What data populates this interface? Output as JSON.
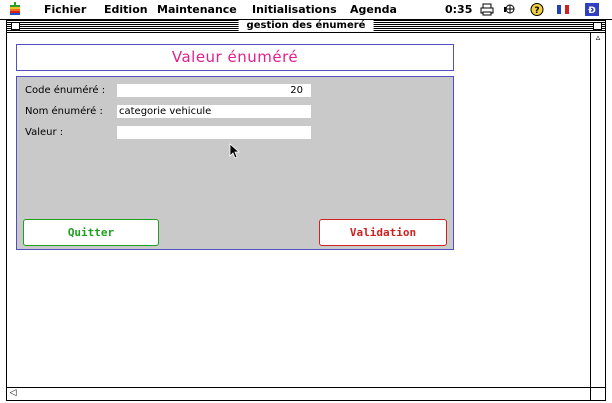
{
  "menubar": {
    "items": [
      "Fichier",
      "Edition",
      "Maintenance",
      "Initialisations",
      "Agenda"
    ],
    "clock": "0:35",
    "icons": [
      "apple-icon",
      "printer-icon",
      "network-icon",
      "help-icon",
      "flag-icon",
      "app-icon"
    ]
  },
  "window": {
    "title": "gestion des énumeré"
  },
  "form": {
    "header": "Valeur énuméré",
    "fields": [
      {
        "label": "Code énuméré :",
        "value": "20"
      },
      {
        "label": "Nom énuméré :",
        "value": "categorie vehicule"
      },
      {
        "label": "Valeur :",
        "value": ""
      }
    ],
    "buttons": {
      "quit": "Quitter",
      "validate": "Validation"
    }
  },
  "colors": {
    "accent": "#e0208e",
    "panel_bg": "#c9c9c9",
    "border_blue": "#5050c0",
    "quit_green": "#20a020",
    "validate_red": "#d02020"
  }
}
